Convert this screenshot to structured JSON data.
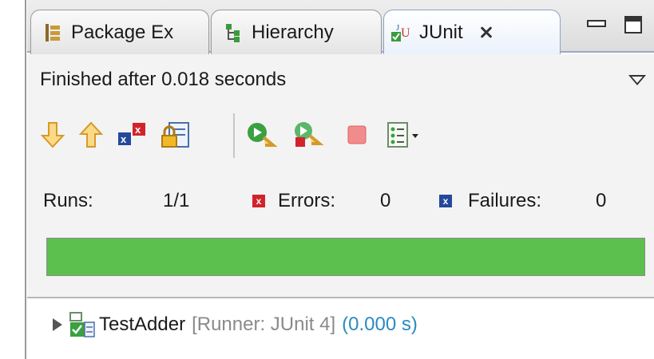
{
  "tabs": [
    {
      "label": "Package Ex",
      "icon": "package-explorer-icon"
    },
    {
      "label": "Hierarchy",
      "icon": "hierarchy-icon"
    },
    {
      "label": "JUnit",
      "icon": "junit-icon",
      "active": true
    }
  ],
  "status": {
    "text": "Finished after 0.018 seconds"
  },
  "toolbar": [
    "next-failure-icon",
    "previous-failure-icon",
    "show-failures-only-icon",
    "scroll-lock-icon",
    "rerun-test-icon",
    "rerun-failed-first-icon",
    "stop-icon",
    "test-run-history-icon"
  ],
  "counters": {
    "runs_label": "Runs:",
    "runs_value": "1/1",
    "errors_label": "Errors:",
    "errors_value": "0",
    "failures_label": "Failures:",
    "failures_value": "0"
  },
  "progress": {
    "fraction": 1.0,
    "color": "#5cc04e"
  },
  "tree": {
    "name": "TestAdder",
    "runner": "[Runner: JUnit 4]",
    "time": "(0.000 s)",
    "icon": "test-suite-success-icon"
  },
  "colors": {
    "error": "#d2232a",
    "failure": "#24489c",
    "duration": "#2a8bc0",
    "runner": "#8a8a8a"
  }
}
